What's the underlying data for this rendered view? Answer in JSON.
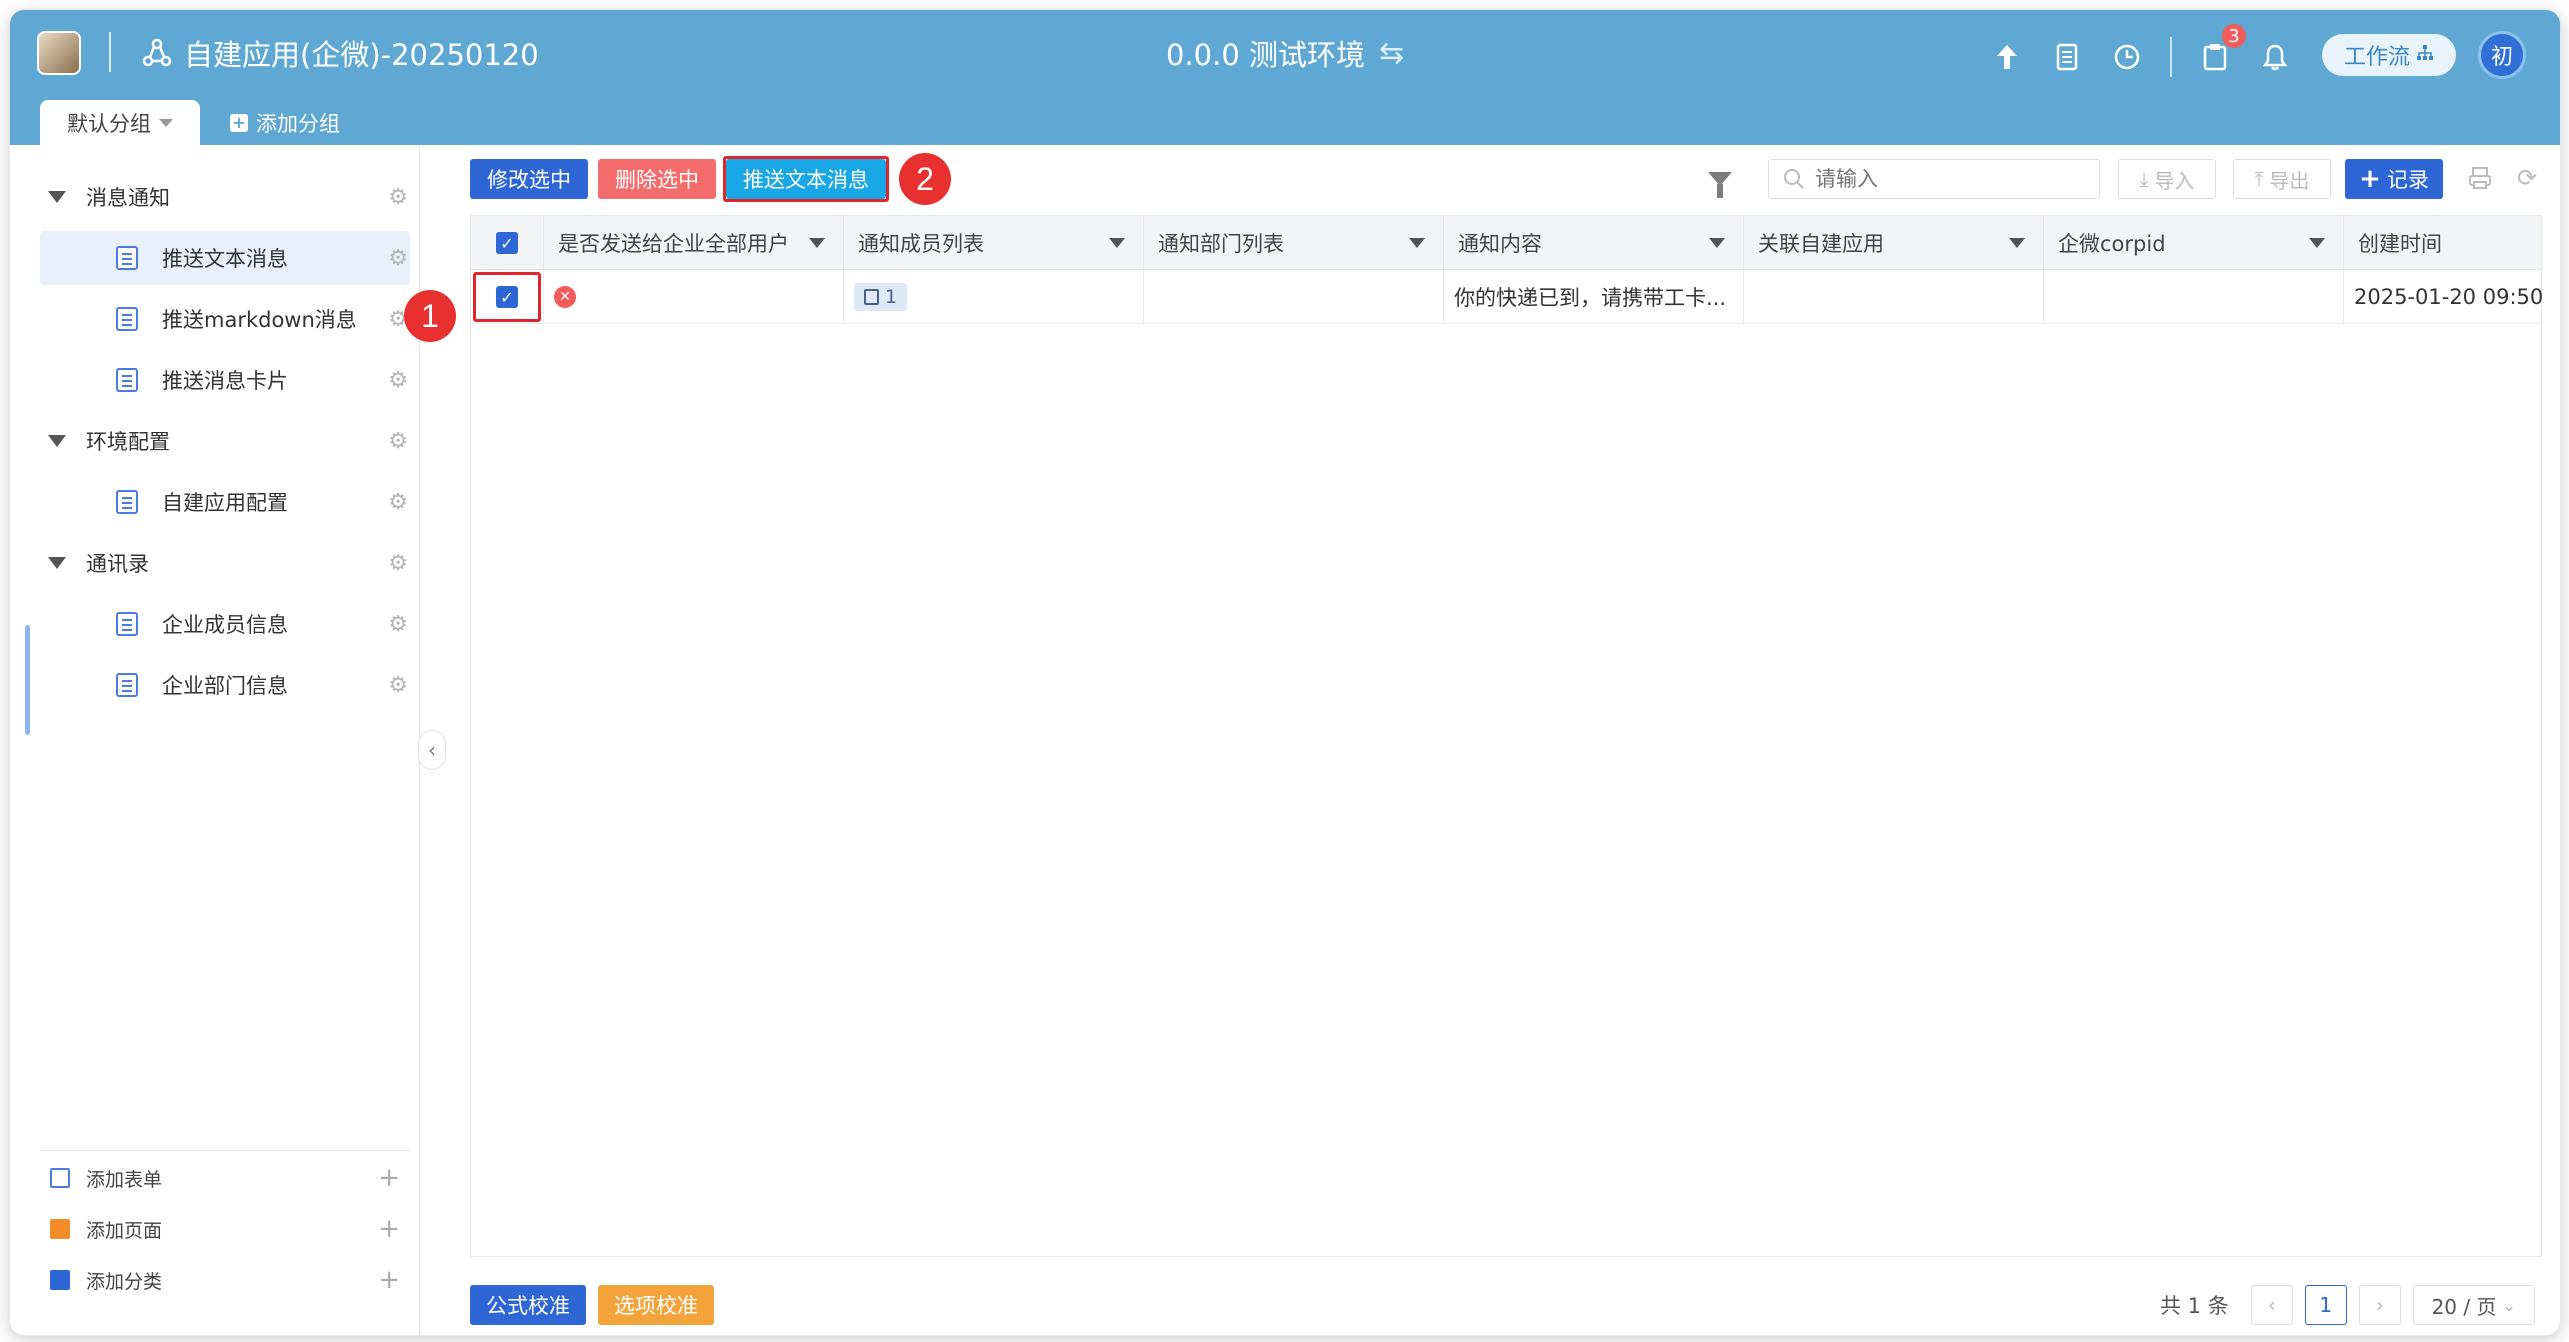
{
  "header": {
    "app_title": "自建应用(企微)-20250120",
    "env_label": "0.0.0 测试环境",
    "notification_count": "3",
    "workflow_label": "工作流",
    "avatar_text": "初"
  },
  "group_tabs": {
    "active": "默认分组",
    "add": "添加分组"
  },
  "sidebar": {
    "groups": [
      {
        "label": "消息通知",
        "items": [
          "推送文本消息",
          "推送markdown消息",
          "推送消息卡片"
        ]
      },
      {
        "label": "环境配置",
        "items": [
          "自建应用配置"
        ]
      },
      {
        "label": "通讯录",
        "items": [
          "企业成员信息",
          "企业部门信息"
        ]
      }
    ],
    "footer": {
      "add_form": "添加表单",
      "add_page": "添加页面",
      "add_category": "添加分类"
    }
  },
  "toolbar": {
    "edit_selected": "修改选中",
    "delete_selected": "删除选中",
    "push_text": "推送文本消息",
    "search_placeholder": "请输入",
    "import": "导入",
    "export": "导出",
    "add_record": "记录"
  },
  "annotations": {
    "step1": "1",
    "step2": "2"
  },
  "table": {
    "columns": [
      "是否发送给企业全部用户",
      "通知成员列表",
      "通知部门列表",
      "通知内容",
      "关联自建应用",
      "企微corpid",
      "创建时间"
    ],
    "rows": [
      {
        "member_count": "1",
        "content": "你的快递已到，请携带工卡...",
        "created": "2025-01-20 09:50:"
      }
    ]
  },
  "footer": {
    "formula_check": "公式校准",
    "option_check": "选项校准",
    "total": "共 1 条",
    "page": "1",
    "page_size": "20 / 页"
  },
  "colors": {
    "header_bg": "#5fa8d3",
    "primary": "#2f66d6",
    "danger": "#f56c6c",
    "push_btn": "#19a7e6",
    "warning": "#f2a33a",
    "annotation_red": "#e8302f"
  }
}
